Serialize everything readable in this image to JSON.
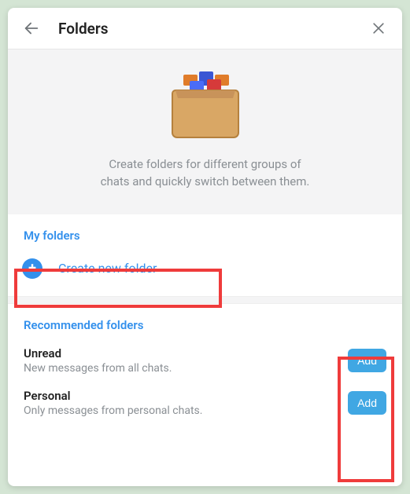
{
  "header": {
    "title": "Folders"
  },
  "intro": {
    "text_line1": "Create folders for different groups of",
    "text_line2": "chats and quickly switch between them."
  },
  "myFolders": {
    "title": "My folders",
    "create_label": "Create new folder"
  },
  "recommended": {
    "title": "Recommended folders",
    "items": [
      {
        "name": "Unread",
        "desc": "New messages from all chats.",
        "button": "Add"
      },
      {
        "name": "Personal",
        "desc": "Only messages from personal chats.",
        "button": "Add"
      }
    ]
  }
}
